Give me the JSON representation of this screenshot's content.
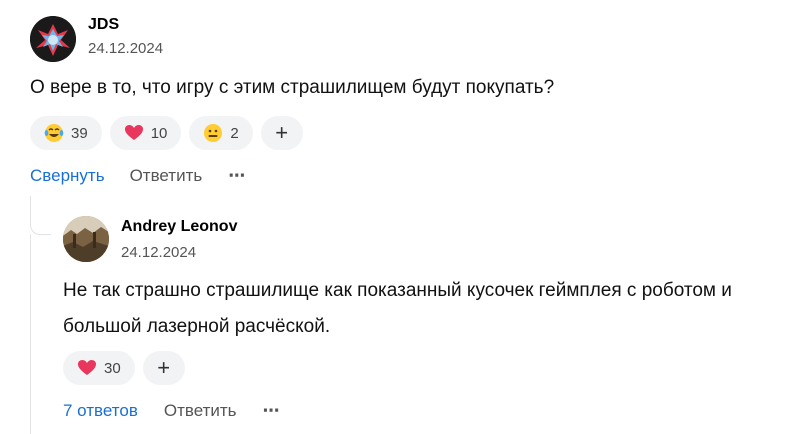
{
  "comments": [
    {
      "author": "JDS",
      "date": "24.12.2024",
      "text": "О вере в то, что игру с этим страшилищем будут покупать?",
      "reactions": [
        {
          "icon": "laugh-cry-emoji",
          "count": "39"
        },
        {
          "icon": "heart-emoji",
          "count": "10"
        },
        {
          "icon": "grimace-emoji",
          "count": "2"
        }
      ],
      "add_reaction": "+",
      "actions": {
        "primary": "Свернуть",
        "reply": "Ответить",
        "more": "⋯"
      }
    },
    {
      "author": "Andrey Leonov",
      "date": "24.12.2024",
      "text": "Не так страшно страшилище как показанный кусочек геймплея с роботом и большой лазерной расчёской.",
      "reactions": [
        {
          "icon": "heart-emoji",
          "count": "30"
        }
      ],
      "add_reaction": "+",
      "actions": {
        "primary": "7 ответов",
        "reply": "Ответить",
        "more": "⋯"
      }
    }
  ],
  "colors": {
    "link": "#1a6fd6",
    "pill_bg": "#f2f3f5",
    "heart": "#e8365d"
  }
}
